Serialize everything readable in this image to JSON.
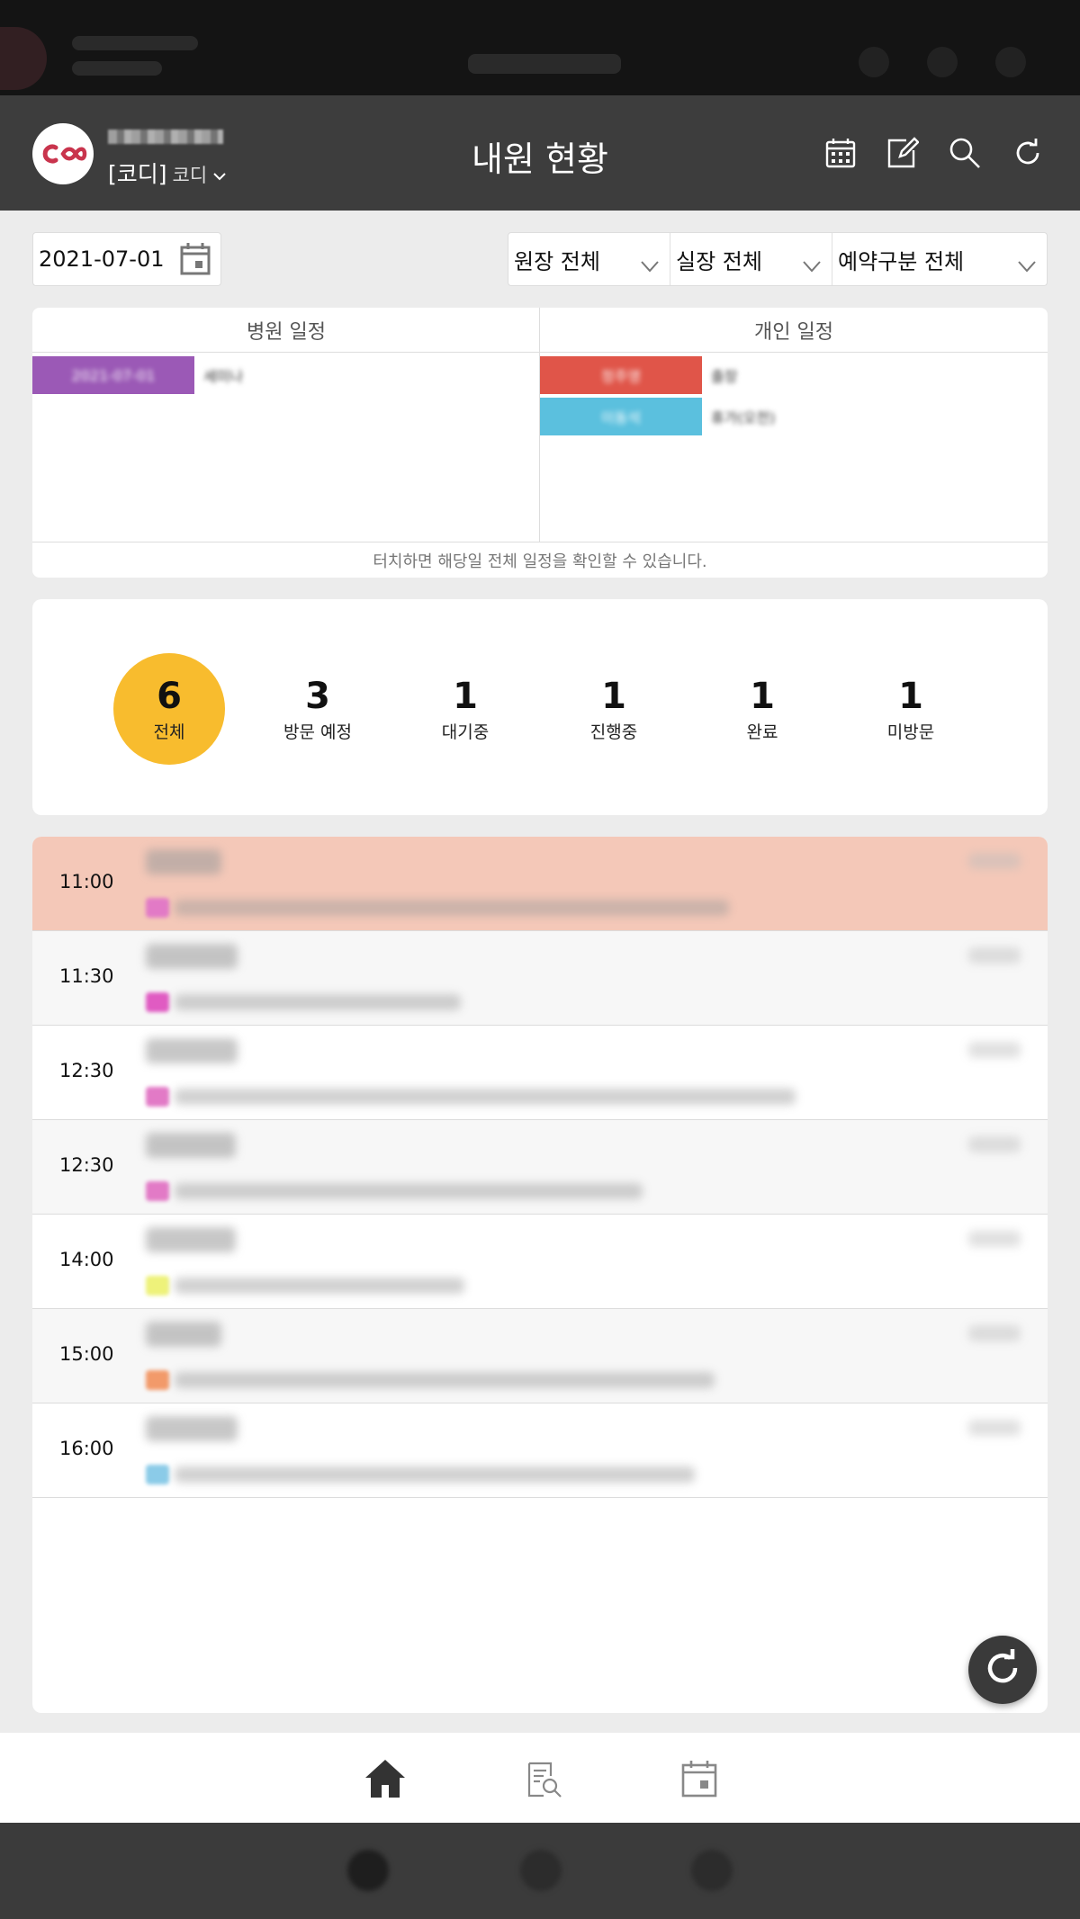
{
  "app": {
    "title": "내원 현황",
    "user_name": "[코디]",
    "user_role": "코디",
    "accent": "#c9344d"
  },
  "filters": {
    "date": "2021-07-01",
    "director": "원장 전체",
    "manager": "실장 전체",
    "reservation_type": "예약구분 전체"
  },
  "schedule": {
    "hospital_header": "병원 일정",
    "personal_header": "개인 일정",
    "hint": "터치하면 해당일 전체 일정을 확인할 수 있습니다.",
    "hospital_events": [
      {
        "badge": "2021-07-01",
        "label": "세미나",
        "color": "#9b59b6"
      }
    ],
    "personal_events": [
      {
        "badge": "정주영",
        "label": "출장",
        "color": "#e05549"
      },
      {
        "badge": "이동석",
        "label": "휴가(오전)",
        "color": "#5bc0de"
      }
    ]
  },
  "stats": [
    {
      "count": "6",
      "label": "전체",
      "active": true
    },
    {
      "count": "3",
      "label": "방문 예정"
    },
    {
      "count": "1",
      "label": "대기중"
    },
    {
      "count": "1",
      "label": "진행중"
    },
    {
      "count": "1",
      "label": "완료"
    },
    {
      "count": "1",
      "label": "미방문"
    }
  ],
  "appointments": [
    {
      "time": "11:00",
      "tag_color": "#e27ac6",
      "bg": "#f4c8b8"
    },
    {
      "time": "11:30",
      "tag_color": "#e05bc2",
      "bg": "#f7f7f7"
    },
    {
      "time": "12:30",
      "tag_color": "#e27ac6",
      "bg": "#ffffff"
    },
    {
      "time": "12:30",
      "tag_color": "#e27ac6",
      "bg": "#f7f7f7"
    },
    {
      "time": "14:00",
      "tag_color": "#eef27a",
      "bg": "#ffffff"
    },
    {
      "time": "15:00",
      "tag_color": "#f29a6a",
      "bg": "#f7f7f7"
    },
    {
      "time": "16:00",
      "tag_color": "#8bcbe8",
      "bg": "#ffffff"
    }
  ],
  "icons": {
    "appbar": [
      "calendar-icon",
      "edit-icon",
      "search-icon",
      "refresh-icon"
    ],
    "nav": [
      "home-icon",
      "search-document-icon",
      "calendar-icon"
    ]
  }
}
